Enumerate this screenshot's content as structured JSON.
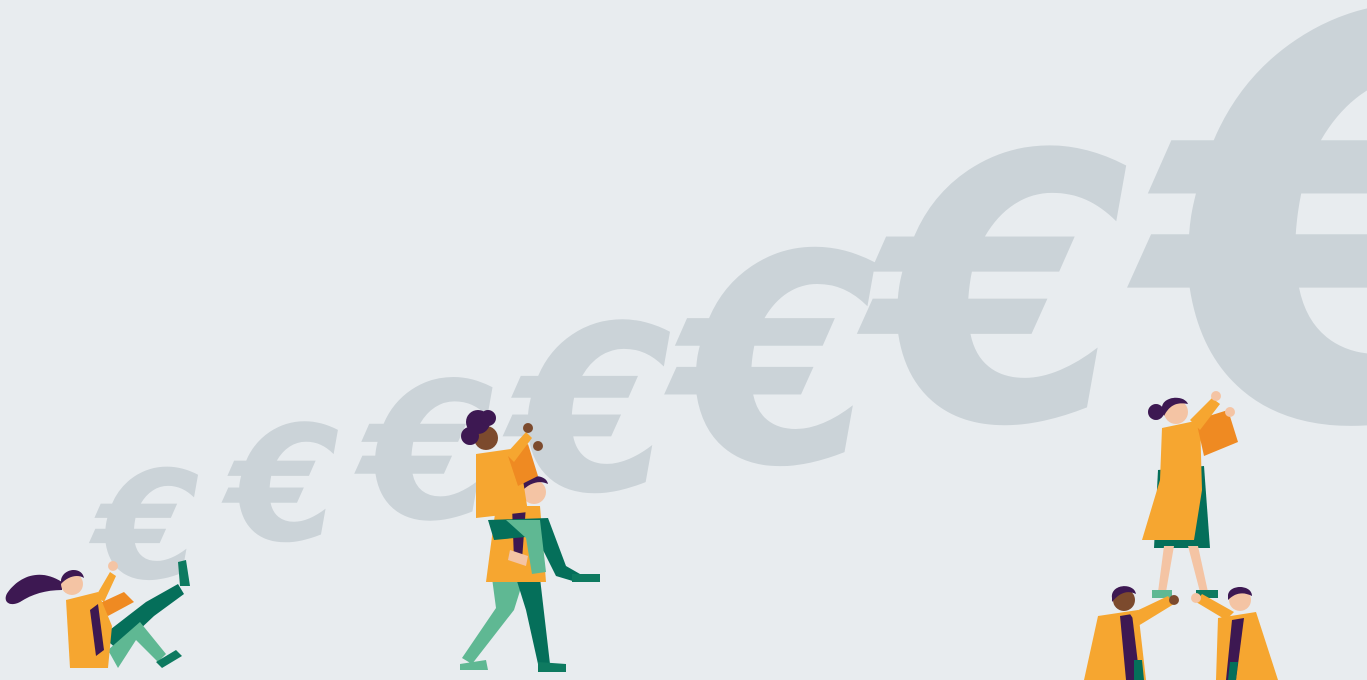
{
  "scene": {
    "background_color": "#e8ecef",
    "palette": {
      "symbol": "#cbd3d8",
      "coat": "#f6a630",
      "coat_shadow": "#ef8a22",
      "teal_dark": "#056f5a",
      "teal_light": "#5fb893",
      "hair": "#3d1852",
      "skin_light": "#f4c4a4",
      "skin_dark": "#7c4a2d",
      "shoe": "#0e7a60"
    },
    "symbols": [
      {
        "glyph": "€",
        "icon": "euro-symbol-icon"
      },
      {
        "glyph": "€",
        "icon": "euro-symbol-icon"
      },
      {
        "glyph": "€",
        "icon": "euro-symbol-icon"
      },
      {
        "glyph": "€",
        "icon": "euro-symbol-icon"
      },
      {
        "glyph": "€",
        "icon": "euro-symbol-icon"
      },
      {
        "glyph": "€",
        "icon": "euro-symbol-icon"
      },
      {
        "glyph": "€",
        "icon": "euro-symbol-icon"
      }
    ],
    "figures": [
      {
        "icon": "falling-woman-icon"
      },
      {
        "icon": "man-carrying-woman-icon"
      },
      {
        "icon": "human-pyramid-icon"
      }
    ]
  }
}
